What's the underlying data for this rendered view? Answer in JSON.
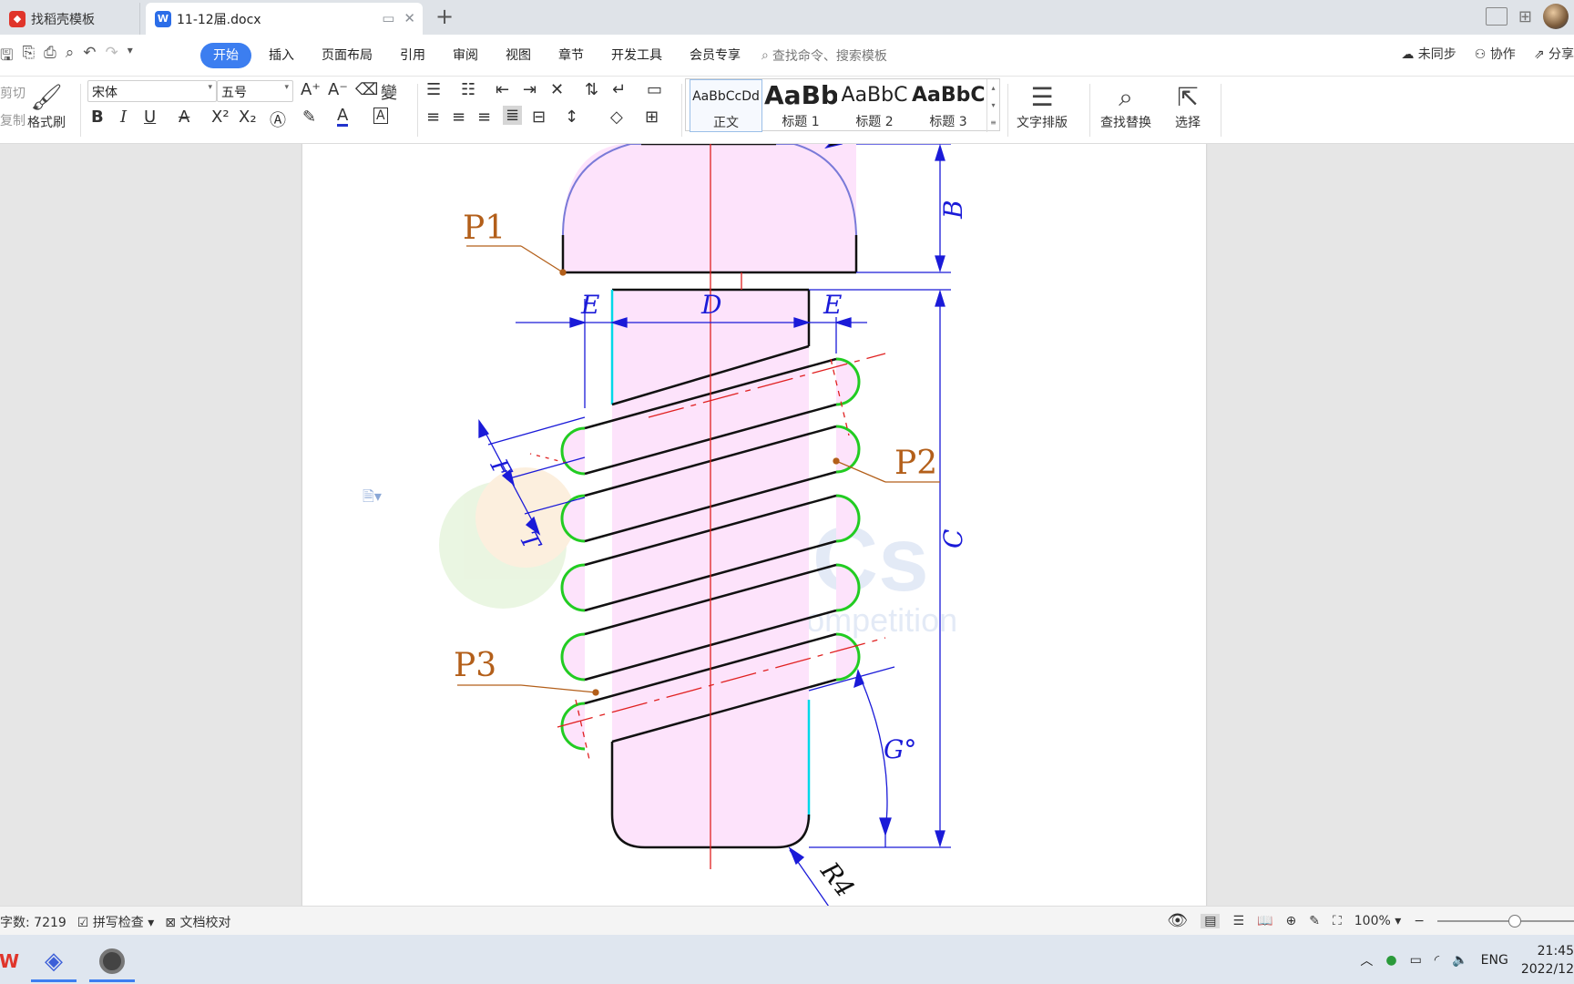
{
  "tabs": [
    {
      "label": "找稻壳模板",
      "active": false,
      "icon": "docer-icon"
    },
    {
      "label": "11-12届.docx",
      "active": true,
      "icon": "wps-writer-icon"
    }
  ],
  "menu": {
    "items": [
      "开始",
      "插入",
      "页面布局",
      "引用",
      "审阅",
      "视图",
      "章节",
      "开发工具",
      "会员专享"
    ],
    "search_placeholder": "查找命令、搜索模板",
    "right": [
      "未同步",
      "协作",
      "分享"
    ]
  },
  "ribbon": {
    "cut": "剪切",
    "copy": "复制",
    "format_painter": "格式刷",
    "font_name": "宋体",
    "font_size": "五号",
    "styles": [
      {
        "preview": "AaBbCcDd",
        "label": "正文"
      },
      {
        "preview": "AaBb",
        "label": "标题 1"
      },
      {
        "preview": "AaBbC",
        "label": "标题 2"
      },
      {
        "preview": "AaBbC",
        "label": "标题 3"
      }
    ],
    "text_layout": "文字排版",
    "find_replace": "查找替换",
    "select": "选择"
  },
  "drawing": {
    "labels": {
      "p1": "P1",
      "p2": "P2",
      "p3": "P3",
      "b": "B",
      "c": "C",
      "d": "D",
      "e_left": "E",
      "e_right": "E",
      "f": "F",
      "t": "T",
      "g": "G°",
      "r": "R4"
    },
    "watermark_main": "CaTiCs",
    "watermark_sub": "CAD digital competition",
    "colors": {
      "fill": "#fde3fb",
      "outline": "#111111",
      "coil": "#22cc22",
      "dim": "#1a1ad8",
      "center": "#e02020",
      "label": "#b35f1a"
    }
  },
  "status": {
    "word_count": "字数: 7219",
    "spell_check": "拼写检查",
    "proofread": "文档校对",
    "zoom": "100%"
  },
  "taskbar": {
    "lang": "ENG",
    "time": "21:45",
    "date": "2022/12"
  }
}
